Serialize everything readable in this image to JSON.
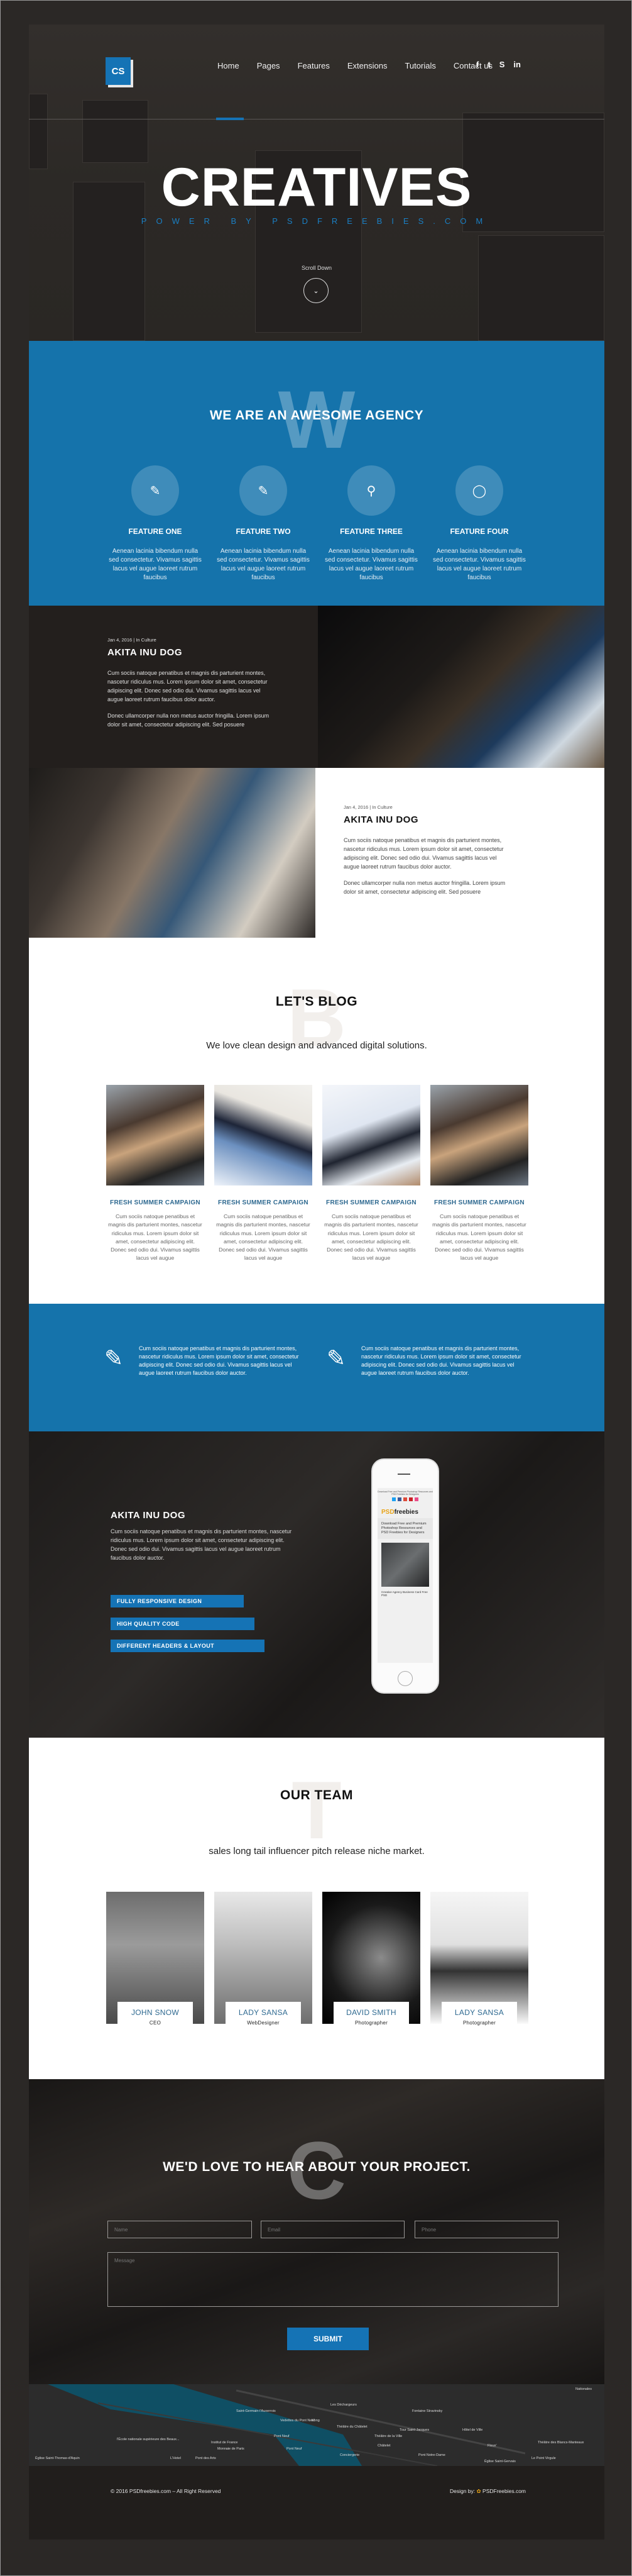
{
  "hero": {
    "logo": "CS",
    "nav": [
      "Home",
      "Pages",
      "Features",
      "Extensions",
      "Tutorials",
      "Contact us"
    ],
    "active_nav": "Home",
    "social": [
      {
        "icon": "facebook-icon",
        "glyph": "f"
      },
      {
        "icon": "twitter-icon",
        "glyph": "t"
      },
      {
        "icon": "skype-icon",
        "glyph": "S"
      },
      {
        "icon": "linkedin-icon",
        "glyph": "in"
      }
    ],
    "title": "CREATIVES",
    "subtitle": "POWER BY PSDFREEBIES.COM",
    "scroll_label": "Scroll Down",
    "scroll_icon": "⌄"
  },
  "agency": {
    "big_letter": "W",
    "title": "WE ARE AN AWESOME AGENCY",
    "features": [
      {
        "icon": "edit-icon",
        "glyph": "✎",
        "title": "FEATURE ONE",
        "text": "Aenean lacinia bibendum nulla sed consectetur. Vivamus sagittis lacus vel augue laoreet rutrum faucibus"
      },
      {
        "icon": "edit-icon",
        "glyph": "✎",
        "title": "FEATURE TWO",
        "text": "Aenean lacinia bibendum nulla sed consectetur. Vivamus sagittis lacus vel augue laoreet rutrum faucibus"
      },
      {
        "icon": "search-icon",
        "glyph": "⚲",
        "title": "FEATURE THREE",
        "text": "Aenean lacinia bibendum nulla sed consectetur. Vivamus sagittis lacus vel augue laoreet rutrum faucibus"
      },
      {
        "icon": "chat-icon",
        "glyph": "◯",
        "title": "FEATURE FOUR",
        "text": "Aenean lacinia bibendum nulla sed consectetur. Vivamus sagittis lacus vel augue laoreet rutrum faucibus"
      }
    ]
  },
  "articles": [
    {
      "meta": "Jan 4, 2016   |   In Culture",
      "title": "AKITA INU DOG",
      "p1": "Cum sociis natoque penatibus et magnis dis parturient montes, nascetur ridiculus mus. Lorem ipsum dolor sit amet, consectetur adipiscing elit. Donec sed odio dui. Vivamus sagittis lacus vel augue laoreet rutrum faucibus dolor auctor.",
      "p2": "Donec ullamcorper nulla non metus auctor fringilla. Lorem ipsum dolor sit amet, consectetur adipiscing elit. Sed posuere"
    },
    {
      "meta": "Jan 4, 2016   |   In Culture",
      "title": "AKITA INU DOG",
      "p1": "Cum sociis natoque penatibus et magnis dis parturient montes, nascetur ridiculus mus. Lorem ipsum dolor sit amet, consectetur adipiscing elit. Donec sed odio dui. Vivamus sagittis lacus vel augue laoreet rutrum faucibus dolor auctor.",
      "p2": "Donec ullamcorper nulla non metus auctor fringilla. Lorem ipsum dolor sit amet, consectetur adipiscing elit. Sed posuere"
    }
  ],
  "blog": {
    "big_letter": "B",
    "title": "LET'S BLOG",
    "subtitle": "We love clean design and advanced digital solutions.",
    "posts": [
      {
        "title": "FRESH SUMMER CAMPAIGN",
        "text": "Cum sociis natoque penatibus et magnis dis parturient montes, nascetur ridiculus mus. Lorem ipsum dolor sit amet, consectetur adipiscing elit. Donec sed odio dui. Vivamus sagittis lacus vel augue"
      },
      {
        "title": "FRESH SUMMER CAMPAIGN",
        "text": "Cum sociis natoque penatibus et magnis dis parturient montes, nascetur ridiculus mus. Lorem ipsum dolor sit amet, consectetur adipiscing elit. Donec sed odio dui. Vivamus sagittis lacus vel augue"
      },
      {
        "title": "FRESH SUMMER CAMPAIGN",
        "text": "Cum sociis natoque penatibus et magnis dis parturient montes, nascetur ridiculus mus. Lorem ipsum dolor sit amet, consectetur adipiscing elit. Donec sed odio dui. Vivamus sagittis lacus vel augue"
      },
      {
        "title": "FRESH SUMMER CAMPAIGN",
        "text": "Cum sociis natoque penatibus et magnis dis parturient montes, nascetur ridiculus mus. Lorem ipsum dolor sit amet, consectetur adipiscing elit. Donec sed odio dui. Vivamus sagittis lacus vel augue"
      }
    ]
  },
  "band": {
    "items": [
      {
        "icon": "edit-icon",
        "glyph": "✎",
        "text": "Cum sociis natoque penatibus et magnis dis parturient montes, nascetur ridiculus mus. Lorem ipsum dolor sit amet, consectetur adipiscing elit. Donec sed odio dui. Vivamus sagittis lacus vel augue laoreet rutrum faucibus dolor auctor."
      },
      {
        "icon": "edit-icon",
        "glyph": "✎",
        "text": "Cum sociis natoque penatibus et magnis dis parturient montes, nascetur ridiculus mus. Lorem ipsum dolor sit amet, consectetur adipiscing elit. Donec sed odio dui. Vivamus sagittis lacus vel augue laoreet rutrum faucibus dolor auctor."
      }
    ]
  },
  "device": {
    "title": "AKITA INU DOG",
    "text": "Cum sociis natoque penatibus et magnis dis parturient montes, nascetur ridiculus mus. Lorem ipsum dolor sit amet, consectetur adipiscing elit. Donec sed odio dui. Vivamus sagittis lacus vel augue laoreet rutrum faucibus dolor auctor.",
    "tags": [
      "FULLY RESPONSIVE DESIGN",
      "HIGH QUALITY CODE",
      "DIFFERENT HEADERS & LAYOUT"
    ],
    "phone": {
      "top_text": "Download Free and Premium Photoshop Resources and PSD Freebies for Designers",
      "logo_a": "PSD",
      "logo_b": "freebies",
      "headline": "Download Free and Premium Photoshop Resources and PSD Freebies for Designers",
      "caption": "Creative Agency Business Card Free PSD",
      "social_colors": [
        "#1da1f2",
        "#3b5998",
        "#dd4b39",
        "#cb2027",
        "#ea4c89"
      ]
    }
  },
  "team": {
    "big_letter": "T",
    "title": "OUR TEAM",
    "subtitle": "sales long tail influencer pitch release niche market.",
    "members": [
      {
        "name": "JOHN SNOW",
        "role": "CEO"
      },
      {
        "name": "LADY SANSA",
        "role": "WebDesigner"
      },
      {
        "name": "DAVID SMITH",
        "role": "Photographer"
      },
      {
        "name": "LADY SANSA",
        "role": "Photographer"
      }
    ]
  },
  "contact": {
    "big_letter": "C",
    "title": "WE'D LOVE TO HEAR ABOUT YOUR PROJECT.",
    "name_placeholder": "Name",
    "email_placeholder": "Email",
    "phone_placeholder": "Phone",
    "message_placeholder": "Message",
    "submit": "SUBMIT"
  },
  "map": {
    "labels": [
      "Saint-Germain-l'Auxerrois",
      "Les Déchargeurs",
      "Kong",
      "Fontaine Stravinsky",
      "Pont des Arts",
      "Pont Neuf",
      "Châtelet",
      "Tour Saint-Jacques",
      "Fleux'",
      "Théâtre des Blancs-Manteaux",
      "Théâtre du Châtelet",
      "Le Point Virgule",
      "Vedettes du Pont Neuf",
      "Théâtre de la Ville",
      "Hôtel de Ville",
      "Institut de France",
      "l'École nationale supérieure des Beaux...",
      "Pont Neuf",
      "Monnaie de Paris",
      "L'Hotel",
      "Conciergerie",
      "Pont Notre-Dame",
      "Église Saint-Thomas-d'Aquin",
      "Église Saint-Gervais",
      "Nationales"
    ]
  },
  "footer": {
    "copyright": "© 2016 PSDfreebies.com – All Right Reserved",
    "design_by": "Design by:",
    "design_brand": "PSDFreebies.com"
  }
}
